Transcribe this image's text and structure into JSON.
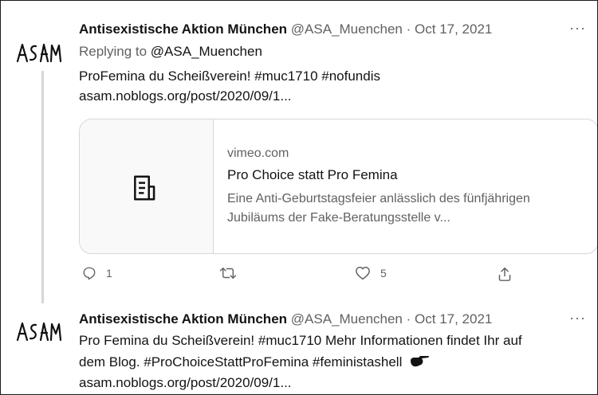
{
  "tweet1": {
    "author_name": "Antisexistische Aktion München",
    "handle": "@ASA_Muenchen",
    "separator": "·",
    "date": "Oct 17, 2021",
    "more": "···",
    "replying_prefix": "Replying to",
    "replying_to": "@ASA_Muenchen",
    "text_line1": "ProFemina du Scheißverein! #muc1710  #nofundis",
    "text_line2": "asam.noblogs.org/post/2020/09/1...",
    "card": {
      "domain": "vimeo.com",
      "title": "Pro Choice statt Pro Femina",
      "description": "Eine Anti-Geburtstagsfeier anlässlich des fünfjährigen Jubiläums der Fake-Beratungsstelle v...",
      "thumb_icon": "document-icon"
    },
    "actions": {
      "reply_count": "1",
      "retweet_count": "",
      "like_count": "5"
    }
  },
  "tweet2": {
    "author_name": "Antisexistische Aktion München",
    "handle": "@ASA_Muenchen",
    "separator": "·",
    "date": "Oct 17, 2021",
    "more": "···",
    "text_line1": "Pro Femina du Scheißverein! #muc1710 Mehr Informationen findet Ihr auf",
    "text_line2": "dem Blog. #ProChoiceStattProFemina #feministashell",
    "text_line3": "asam.noblogs.org/post/2020/09/1..."
  },
  "avatar_text": "ASAM"
}
